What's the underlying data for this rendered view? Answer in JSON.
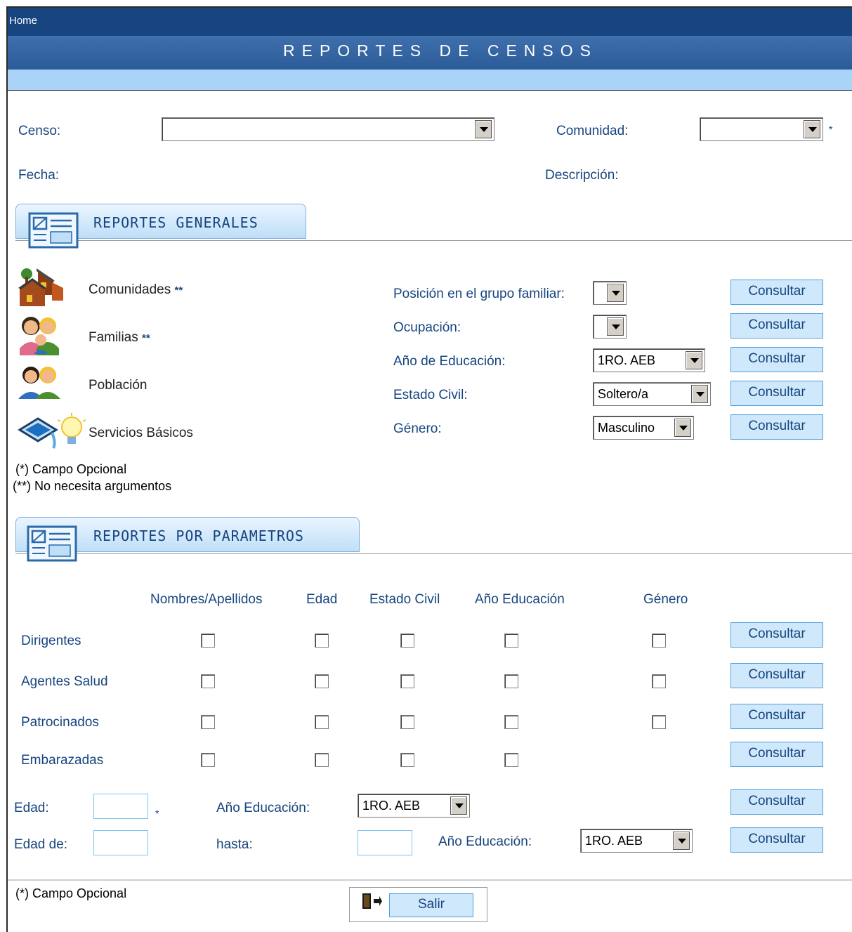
{
  "header": {
    "home": "Home",
    "title": "REPORTES DE CENSOS"
  },
  "filters": {
    "censo_label": "Censo:",
    "censo_value": "",
    "comunidad_label": "Comunidad:",
    "comunidad_value": "",
    "comunidad_required": "*",
    "fecha_label": "Fecha:",
    "descripcion_label": "Descripción:"
  },
  "general": {
    "title": "REPORTES GENERALES",
    "items": [
      {
        "label": "Comunidades",
        "mark": "**",
        "icon": "houses-icon"
      },
      {
        "label": "Familias",
        "mark": "**",
        "icon": "family-icon"
      },
      {
        "label": "Población",
        "mark": "",
        "icon": "population-icon"
      },
      {
        "label": "Servicios Básicos",
        "mark": "",
        "icon": "water-light-icon"
      }
    ],
    "queries": [
      {
        "label": "Posición en el grupo familiar:",
        "value": "",
        "button": "Consultar"
      },
      {
        "label": "Ocupación:",
        "value": "",
        "button": "Consultar"
      },
      {
        "label": "Año de Educación:",
        "value": "1RO. AEB",
        "button": "Consultar"
      },
      {
        "label": "Estado Civil:",
        "value": "Soltero/a",
        "button": "Consultar"
      },
      {
        "label": "Género:",
        "value": "Masculino",
        "button": "Consultar"
      }
    ],
    "note1": "(*) Campo Opcional",
    "note2": "(**) No necesita argumentos"
  },
  "params": {
    "title": "REPORTES POR PARAMETROS",
    "columns": [
      "Nombres/Apellidos",
      "Edad",
      "Estado Civil",
      "Año Educación",
      "Género"
    ],
    "rows": [
      {
        "label": "Dirigentes",
        "button": "Consultar"
      },
      {
        "label": "Agentes Salud",
        "button": "Consultar"
      },
      {
        "label": "Patrocinados",
        "button": "Consultar"
      },
      {
        "label": "Embarazadas",
        "button": "Consultar"
      }
    ],
    "edad_label": "Edad:",
    "edad_required": "*",
    "anio_label": "Año Educación:",
    "anio_value": "1RO. AEB",
    "edad_de_label": "Edad de:",
    "hasta_label": "hasta:",
    "anio2_label": "Año Educación:",
    "anio2_value": "1RO. AEB",
    "button": "Consultar"
  },
  "footer": {
    "note": "(*) Campo Opcional",
    "salir": "Salir"
  }
}
